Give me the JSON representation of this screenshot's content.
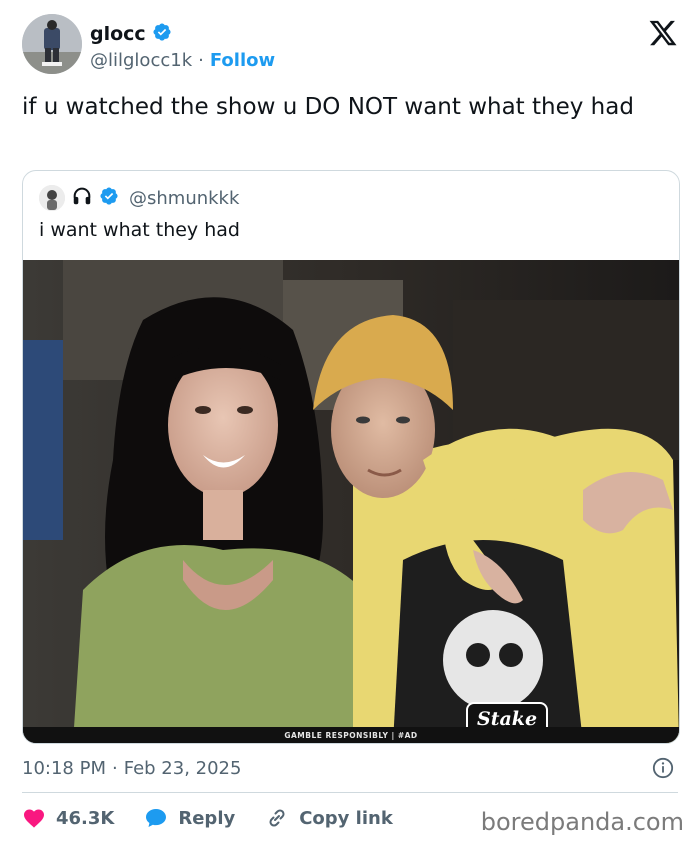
{
  "author": {
    "display_name": "glocc",
    "handle": "@lilglocc1k",
    "separator": "·",
    "follow_label": "Follow"
  },
  "tweet": {
    "text": "if u watched the show u DO NOT want what they had"
  },
  "quoted_tweet": {
    "handle": "@shmunkkk",
    "text": "i want what they had",
    "ad_bar_text": "GAMBLE RESPONSIBLY  |  #AD",
    "stake_logo_text": "Stake"
  },
  "meta": {
    "time": "10:18 PM",
    "separator": "·",
    "date": "Feb 23, 2025"
  },
  "actions": {
    "like_count": "46.3K",
    "reply_label": "Reply",
    "copy_link_label": "Copy link"
  },
  "watermark": "boredpanda.com",
  "colors": {
    "accent": "#1d9bf0",
    "like": "#f91880",
    "text_primary": "#0f1419",
    "text_secondary": "#536471",
    "border": "#cfd9de"
  },
  "icons": {
    "verified": "verified-badge-icon",
    "x_logo": "x-logo-icon",
    "headphones": "headphones-icon",
    "info": "info-icon",
    "heart": "heart-icon",
    "reply": "speech-bubble-icon",
    "link": "link-icon"
  }
}
